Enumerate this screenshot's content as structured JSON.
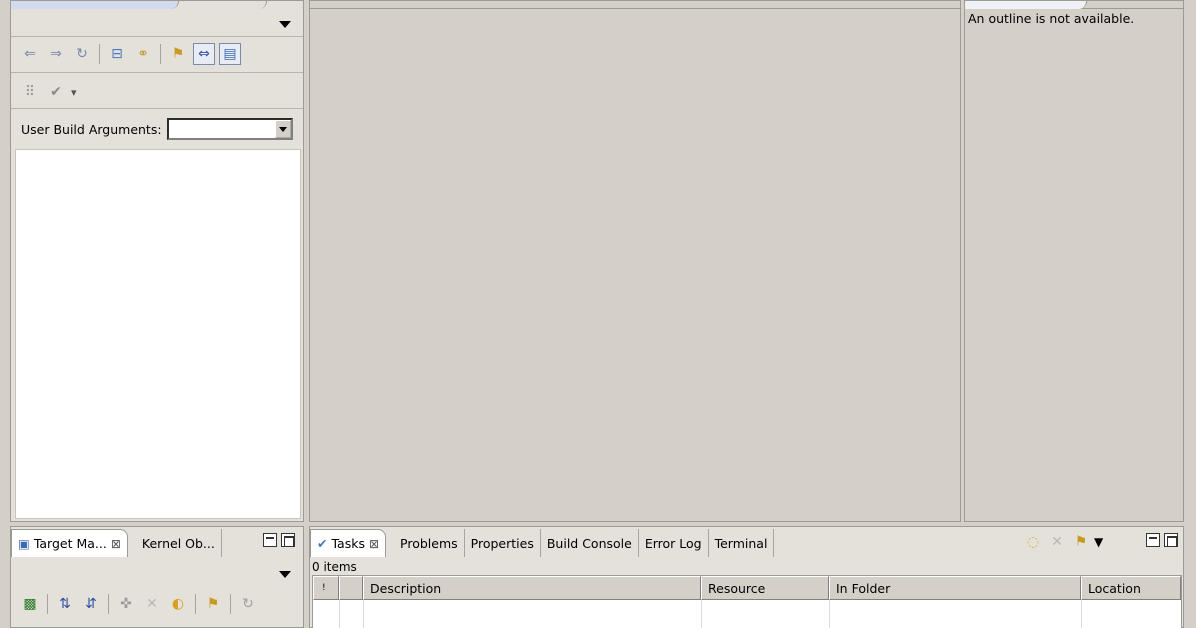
{
  "left_view": {
    "build_args_label": "User Build Arguments:",
    "build_args_value": "",
    "toolbar1": [
      "back-icon",
      "forward-icon",
      "refresh-icon",
      "collapse-icon",
      "link-icon",
      "build-icon",
      "toggle-icon",
      "filter-icon"
    ],
    "toolbar2": [
      "fetch-icon",
      "check-icon"
    ]
  },
  "outline_view": {
    "message": "An outline is not available."
  },
  "bottom_left_view": {
    "tabs": [
      {
        "label": "Target Ma...",
        "active": true
      },
      {
        "label": "Kernel Ob...",
        "active": false
      }
    ]
  },
  "tasks_view": {
    "tabs": [
      {
        "label": "Tasks",
        "active": true
      },
      {
        "label": "Problems",
        "active": false
      },
      {
        "label": "Properties",
        "active": false
      },
      {
        "label": "Build Console",
        "active": false
      },
      {
        "label": "Error Log",
        "active": false
      },
      {
        "label": "Terminal",
        "active": false
      }
    ],
    "count": "0 items",
    "columns": [
      "",
      "",
      "Description",
      "Resource",
      "In Folder",
      "Location"
    ]
  }
}
